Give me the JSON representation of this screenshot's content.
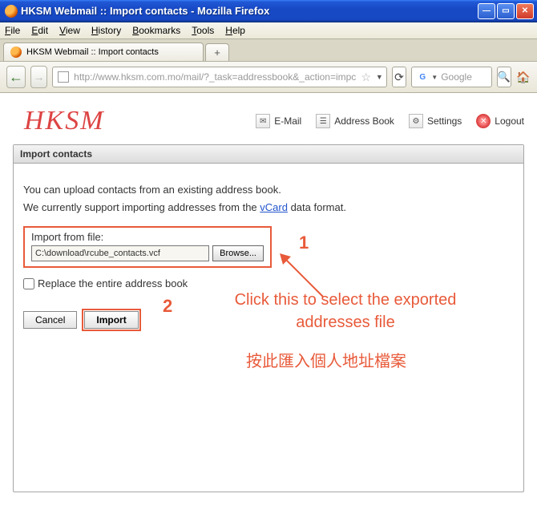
{
  "window": {
    "title": "HKSM Webmail :: Import contacts - Mozilla Firefox"
  },
  "menubar": {
    "file": "File",
    "edit": "Edit",
    "view": "View",
    "history": "History",
    "bookmarks": "Bookmarks",
    "tools": "Tools",
    "help": "Help"
  },
  "tab": {
    "title": "HKSM Webmail :: Import contacts",
    "new_tab": "+"
  },
  "navbar": {
    "url": "http://www.hksm.com.mo/mail/?_task=addressbook&_action=impc",
    "search_placeholder": "Google"
  },
  "app": {
    "logo": "HKSM",
    "nav": {
      "email": "E-Mail",
      "addressbook": "Address Book",
      "settings": "Settings",
      "logout": "Logout"
    }
  },
  "panel": {
    "title": "Import contacts",
    "intro1": "You can upload contacts from an existing address book.",
    "intro2_pre": "We currently support importing addresses from the ",
    "intro2_link": "vCard",
    "intro2_post": " data format.",
    "file_label": "Import from file:",
    "file_value": "C:\\download\\rcube_contacts.vcf",
    "browse": "Browse...",
    "replace": "Replace the entire address book",
    "cancel": "Cancel",
    "import": "Import"
  },
  "annotations": {
    "n1": "1",
    "n2": "2",
    "text_en": "Click this to select the exported addresses file",
    "text_cn": "按此匯入個人地址檔案"
  }
}
